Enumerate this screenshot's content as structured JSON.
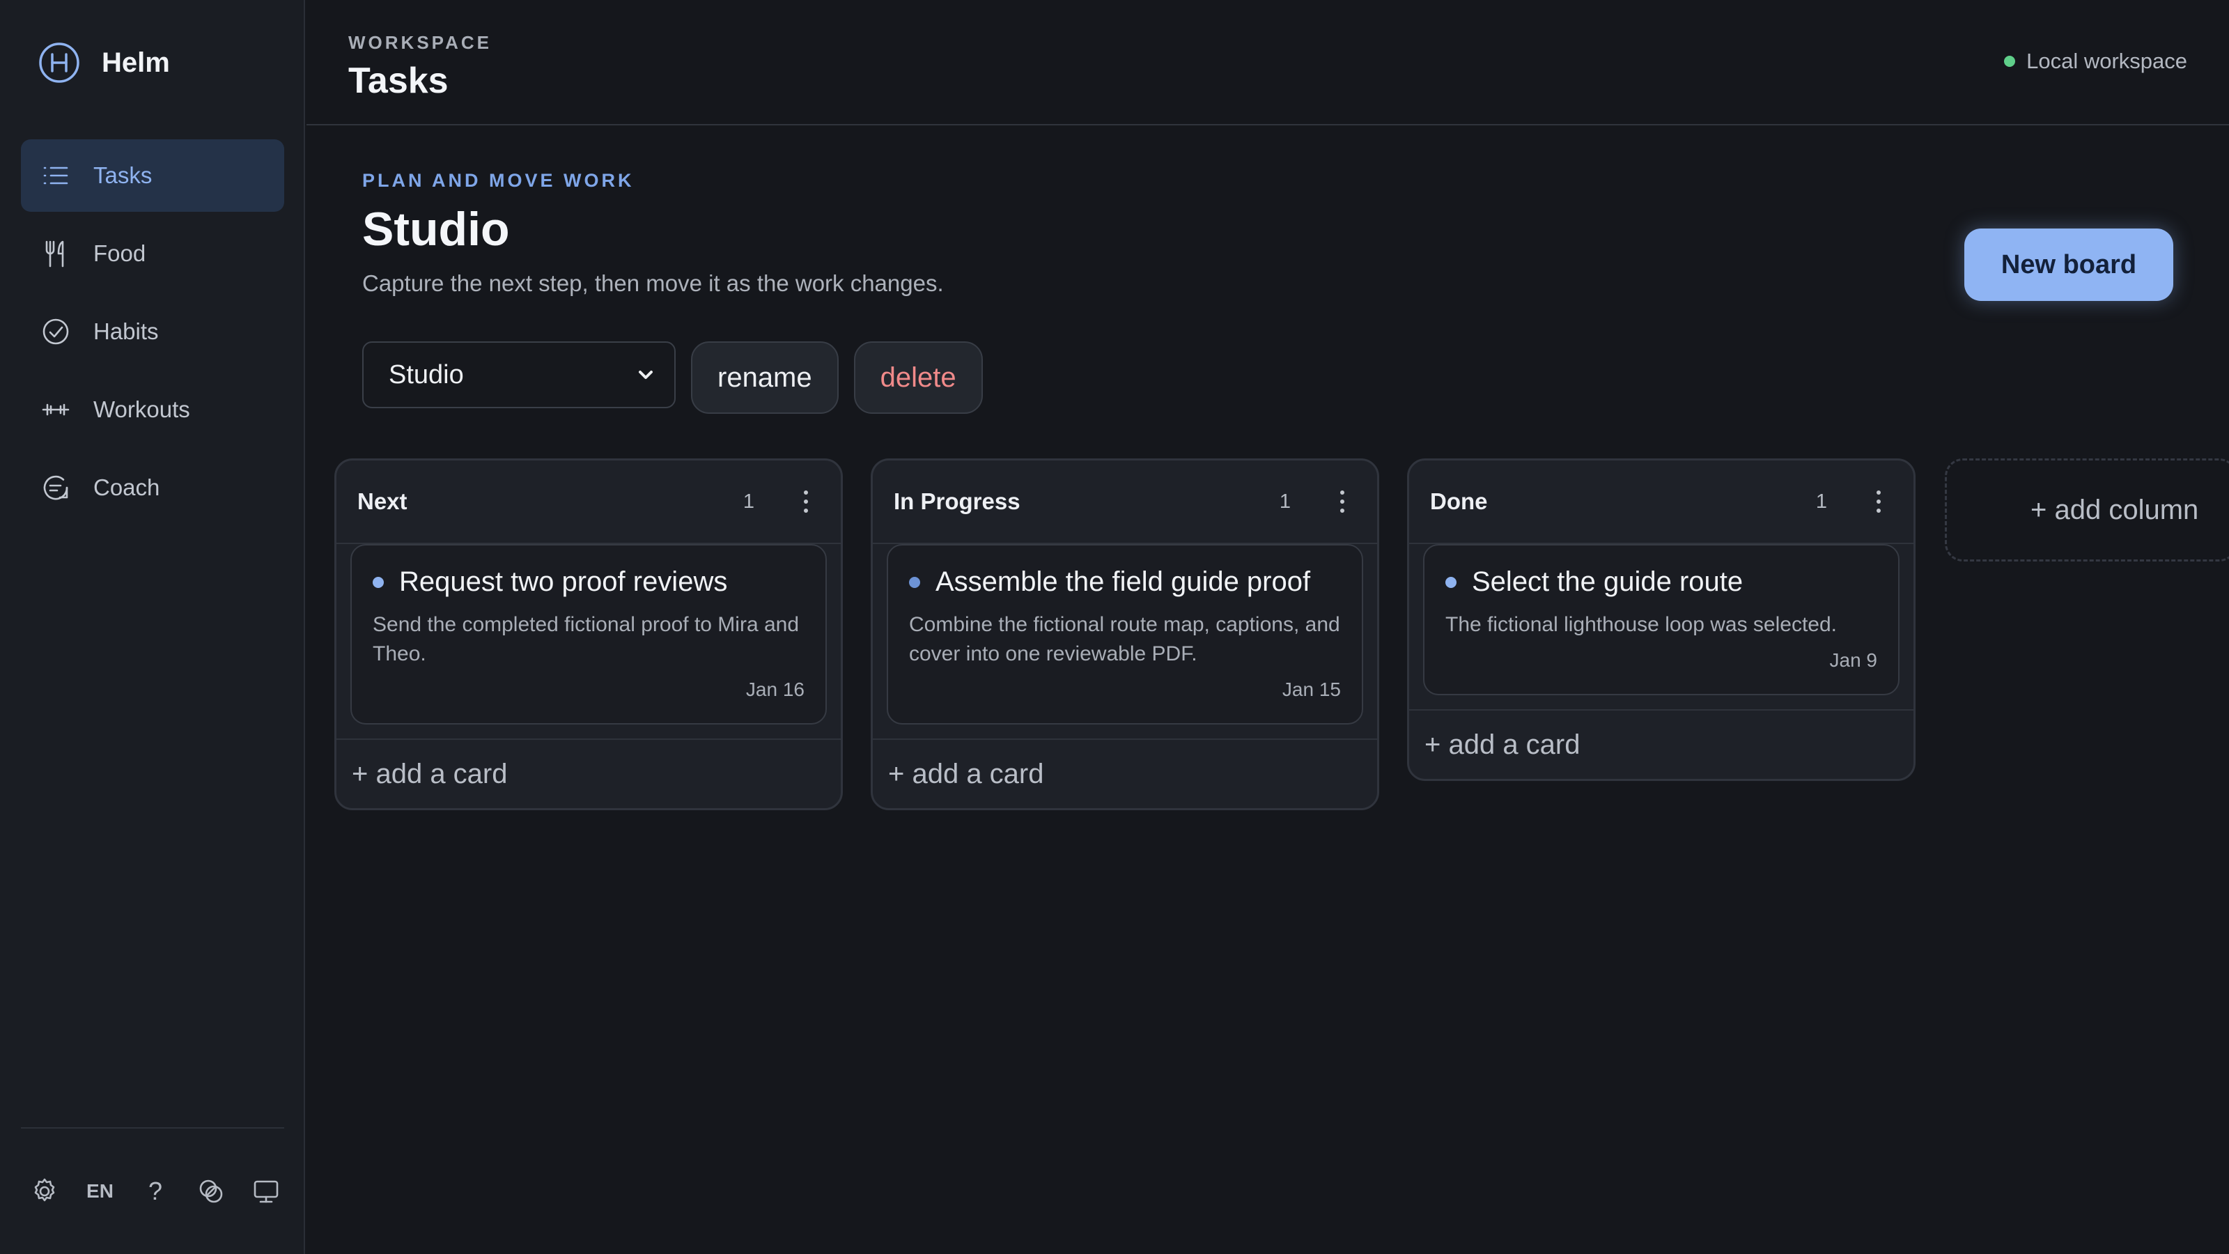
{
  "brand": {
    "name": "Helm",
    "logo_icon": "helm-logo-icon"
  },
  "sidebar": {
    "items": [
      {
        "label": "Tasks",
        "icon": "list-icon",
        "active": true
      },
      {
        "label": "Food",
        "icon": "utensils-icon",
        "active": false
      },
      {
        "label": "Habits",
        "icon": "check-circle-icon",
        "active": false
      },
      {
        "label": "Workouts",
        "icon": "dumbbell-icon",
        "active": false
      },
      {
        "label": "Coach",
        "icon": "chat-icon",
        "active": false
      }
    ],
    "footer": {
      "settings_icon": "gear-icon",
      "language": "EN",
      "help": "?",
      "theme_icon": "contrast-icon",
      "display_icon": "monitor-icon"
    }
  },
  "header": {
    "eyebrow": "WORKSPACE",
    "title": "Tasks",
    "status": "Local workspace"
  },
  "board": {
    "eyebrow": "PLAN AND MOVE WORK",
    "title": "Studio",
    "subtitle": "Capture the next step, then move it as the work changes.",
    "new_board_label": "New board",
    "selected": "Studio",
    "rename_label": "rename",
    "delete_label": "delete"
  },
  "columns": [
    {
      "title": "Next",
      "count": "1",
      "cards": [
        {
          "title": "Request two proof reviews",
          "desc": "Send the completed fictional proof to Mira and Theo.",
          "date": "Jan 16"
        }
      ],
      "add_label": "+ add a card"
    },
    {
      "title": "In Progress",
      "count": "1",
      "cards": [
        {
          "title": "Assemble the field guide proof",
          "desc": "Combine the fictional route map, captions, and cover into one reviewable PDF.",
          "date": "Jan 15"
        }
      ],
      "add_label": "+ add a card"
    },
    {
      "title": "Done",
      "count": "1",
      "cards": [
        {
          "title": "Select the guide route",
          "desc": "The fictional lighthouse loop was selected.",
          "date": "Jan 9"
        }
      ],
      "add_label": "+ add a card"
    }
  ],
  "add_column_label": "+ add column",
  "colors": {
    "accent": "#8fb4f3",
    "danger": "#f08a8a",
    "status": "#5fcf8a",
    "background": "#15171c"
  }
}
